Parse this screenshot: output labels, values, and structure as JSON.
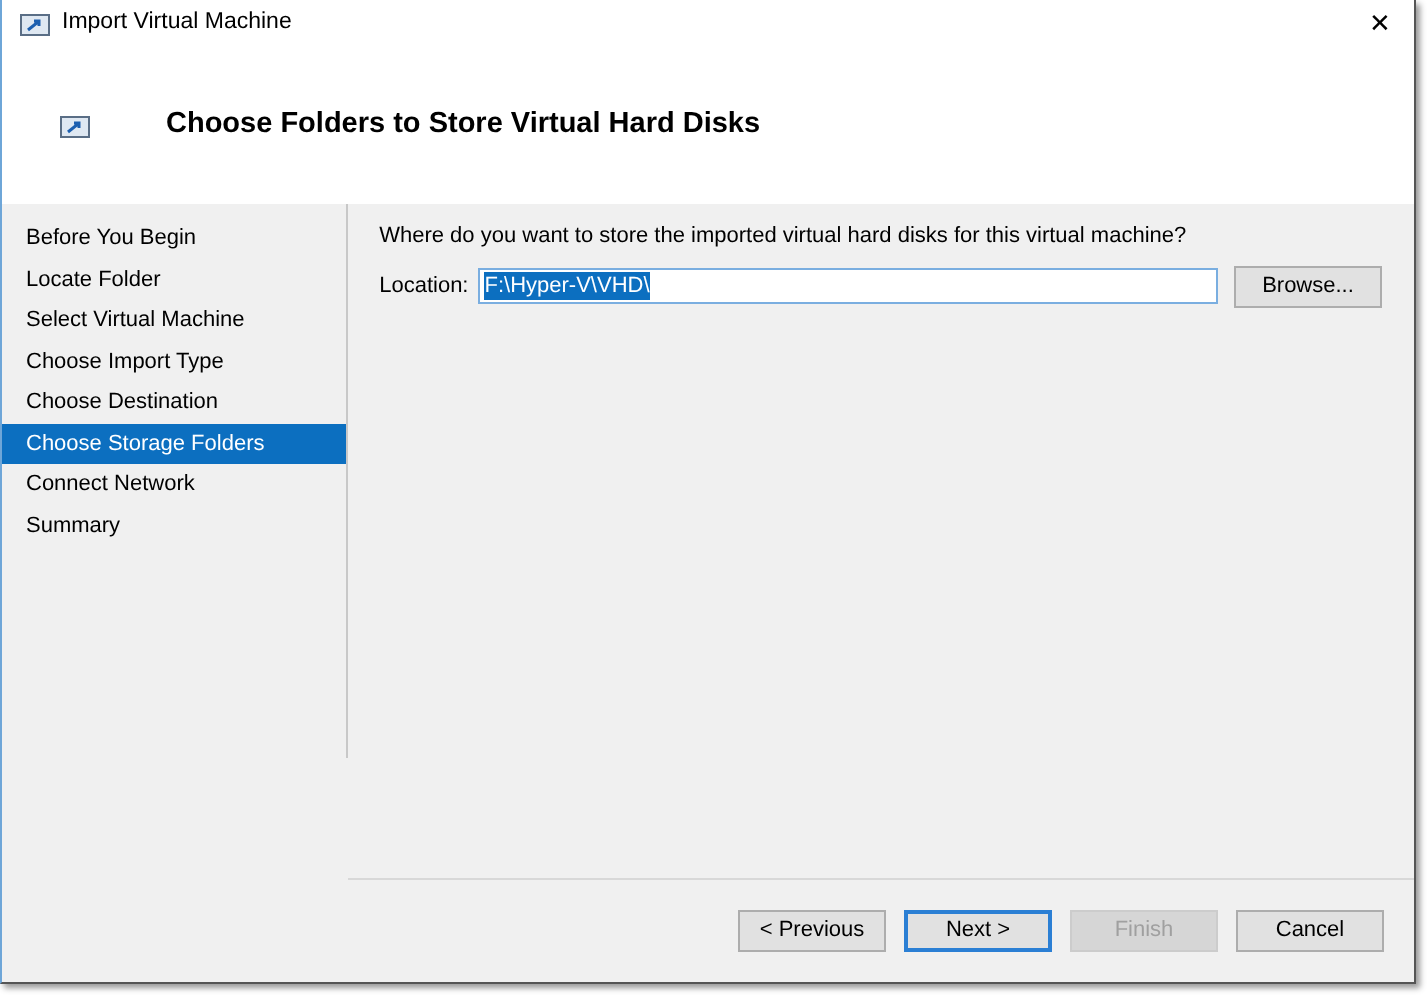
{
  "window": {
    "title": "Import Virtual Machine",
    "close": "✕"
  },
  "header": {
    "title": "Choose Folders to Store Virtual Hard Disks"
  },
  "steps": [
    {
      "label": "Before You Begin",
      "selected": false
    },
    {
      "label": "Locate Folder",
      "selected": false
    },
    {
      "label": "Select Virtual Machine",
      "selected": false
    },
    {
      "label": "Choose Import Type",
      "selected": false
    },
    {
      "label": "Choose Destination",
      "selected": false
    },
    {
      "label": "Choose Storage Folders",
      "selected": true
    },
    {
      "label": "Connect Network",
      "selected": false
    },
    {
      "label": "Summary",
      "selected": false
    }
  ],
  "prompt": "Where do you want to store the imported virtual hard disks for this virtual machine?",
  "location": {
    "label": "Location:",
    "value": "F:\\Hyper-V\\VHD\\",
    "browse": "Browse..."
  },
  "buttons": [
    {
      "label": "< Previous",
      "disabled": false,
      "default": false
    },
    {
      "label": "Next >",
      "disabled": false,
      "default": true
    },
    {
      "label": "Finish",
      "disabled": true,
      "default": false
    },
    {
      "label": "Cancel",
      "disabled": false,
      "default": false
    }
  ]
}
